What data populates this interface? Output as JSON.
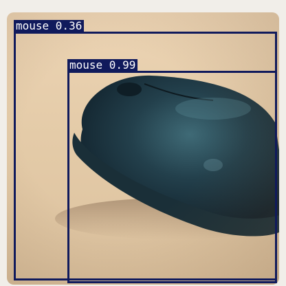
{
  "image": {
    "description_colors": {
      "background": "#e4cba8",
      "mouse_body": "#243c48",
      "box_color": "#101a5c"
    }
  },
  "detections": [
    {
      "label_text": "mouse 0.36",
      "class": "mouse",
      "score": 0.36
    },
    {
      "label_text": "mouse 0.99",
      "class": "mouse",
      "score": 0.99
    }
  ]
}
